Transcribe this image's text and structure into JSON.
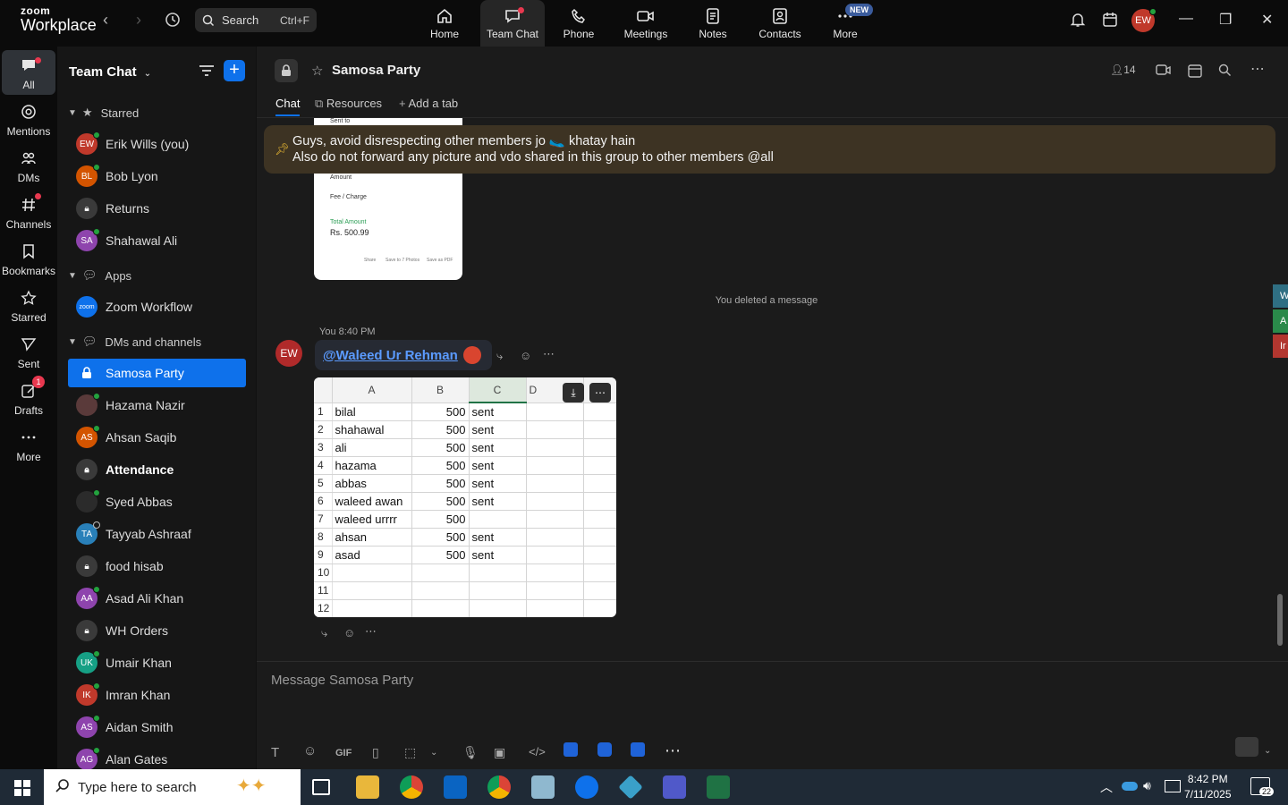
{
  "app": {
    "logo_line1": "zoom",
    "logo_line2": "Workplace",
    "search_label": "Search",
    "search_shortcut": "Ctrl+F",
    "user_initials": "EW"
  },
  "topnav": [
    {
      "label": "Home",
      "icon": "home-icon"
    },
    {
      "label": "Team Chat",
      "icon": "chat-icon"
    },
    {
      "label": "Phone",
      "icon": "phone-icon"
    },
    {
      "label": "Meetings",
      "icon": "video-icon"
    },
    {
      "label": "Notes",
      "icon": "notes-icon"
    },
    {
      "label": "Contacts",
      "icon": "contacts-icon"
    },
    {
      "label": "More",
      "icon": "more-icon",
      "badge": "NEW"
    }
  ],
  "rail": [
    {
      "label": "All"
    },
    {
      "label": "Mentions"
    },
    {
      "label": "DMs"
    },
    {
      "label": "Channels"
    },
    {
      "label": "Bookmarks"
    },
    {
      "label": "Starred"
    },
    {
      "label": "Sent"
    },
    {
      "label": "Drafts",
      "badge": "1"
    },
    {
      "label": "More"
    }
  ],
  "sidebar": {
    "title": "Team Chat",
    "sections": {
      "starred": "Starred",
      "apps": "Apps",
      "dms": "DMs and channels"
    },
    "starred": [
      {
        "name": "Erik Wills (you)",
        "initials": "EW",
        "color": "#c0392b"
      },
      {
        "name": "Bob Lyon",
        "initials": "BL",
        "color": "#d35400"
      },
      {
        "name": "Returns",
        "initials": "",
        "color": "#3a3a3a"
      },
      {
        "name": "Shahawal Ali",
        "initials": "SA",
        "color": "#8e44ad"
      }
    ],
    "apps": [
      {
        "name": "Zoom Workflow",
        "initials": "zoom",
        "color": "#0e71eb"
      }
    ],
    "dms": [
      {
        "name": "Samosa Party",
        "initials": "",
        "color": "#0e71eb"
      },
      {
        "name": "Hazama Nazir",
        "initials": "",
        "color": "#5a3a3a"
      },
      {
        "name": "Ahsan Saqib",
        "initials": "AS",
        "color": "#d35400"
      },
      {
        "name": "Attendance",
        "initials": "",
        "color": "#3a3a3a"
      },
      {
        "name": "Syed Abbas",
        "initials": "",
        "color": "#2b2b2b"
      },
      {
        "name": "Tayyab Ashraaf",
        "initials": "TA",
        "color": "#2980b9"
      },
      {
        "name": "food hisab",
        "initials": "",
        "color": "#3a3a3a"
      },
      {
        "name": "Asad Ali Khan",
        "initials": "AA",
        "color": "#8e44ad"
      },
      {
        "name": "WH Orders",
        "initials": "",
        "color": "#3a3a3a"
      },
      {
        "name": "Umair Khan",
        "initials": "UK",
        "color": "#16a085"
      },
      {
        "name": "Imran Khan",
        "initials": "IK",
        "color": "#c0392b"
      },
      {
        "name": "Aidan Smith",
        "initials": "AS",
        "color": "#8e44ad"
      },
      {
        "name": "Alan Gates",
        "initials": "AG",
        "color": "#8e44ad"
      }
    ]
  },
  "channel": {
    "title": "Samosa Party",
    "member_count": "14",
    "tabs": [
      "Chat",
      "Resources",
      "Add a tab"
    ]
  },
  "pinned": {
    "line1": "Guys, avoid disrespecting other members jo 🥿 khatay hain",
    "line2": "Also do not forward any picture and vdo shared in this group to other members @all"
  },
  "receipt": {
    "sent_to": "Sent to",
    "amount_label": "Amount",
    "fee_label": "Fee / Charge",
    "total_label": "Total Amount",
    "total_value": "Rs. 500.99",
    "actions": [
      "Share",
      "Save to 7 Photos",
      "Save as PDF"
    ]
  },
  "system_message": "You deleted a message",
  "message": {
    "meta": "You 8:40 PM",
    "sender_initials": "EW",
    "mention": "@Waleed Ur Rehman"
  },
  "sheet": {
    "columns": [
      "A",
      "B",
      "C",
      "D",
      "E"
    ],
    "rows": [
      [
        "1",
        "bilal",
        "500",
        "sent"
      ],
      [
        "2",
        "shahawal",
        "500",
        "sent"
      ],
      [
        "3",
        "ali",
        "500",
        "sent"
      ],
      [
        "4",
        "hazama",
        "500",
        "sent"
      ],
      [
        "5",
        "abbas",
        "500",
        "sent"
      ],
      [
        "6",
        "waleed awan",
        "500",
        "sent"
      ],
      [
        "7",
        "waleed urrrr",
        "500",
        ""
      ],
      [
        "8",
        "ahsan",
        "500",
        "sent"
      ],
      [
        "9",
        "asad",
        "500",
        "sent"
      ],
      [
        "10",
        "",
        "",
        ""
      ],
      [
        "11",
        "",
        "",
        ""
      ],
      [
        "12",
        "",
        "",
        ""
      ]
    ]
  },
  "compose": {
    "placeholder": "Message Samosa Party",
    "gif_label": "GIF"
  },
  "edge_tabs": [
    "W",
    "A",
    "Ir"
  ],
  "taskbar": {
    "search_placeholder": "Type here to search",
    "time": "8:42 PM",
    "date": "7/11/2025",
    "notification_count": "22"
  }
}
